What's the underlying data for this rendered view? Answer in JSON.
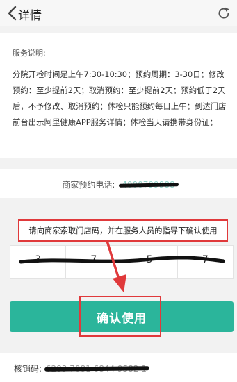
{
  "header": {
    "title": "详情",
    "back_icon": "chevron-left-icon",
    "refresh_icon": "refresh-icon"
  },
  "service": {
    "label": "服务说明:",
    "description": "分院开检时间是上午7:30-10:30；预约周期：3-30日；修改预约：至少提前2天；取消预约：至少提前2天；预约低于2天后，不予修改、取消预约；体检只能预约每日上午；到达门店前台出示阿里健康APP服务详情；体检当天请携带身份证；"
  },
  "phone": {
    "label": "商家预约电话:",
    "value": "4000799988"
  },
  "instruction": {
    "text": "请向商家索取门店码，并在服务人员的指导下确认使用"
  },
  "store_code": {
    "cells": [
      "3",
      "7",
      "5",
      "7"
    ]
  },
  "confirm": {
    "label": "确认使用"
  },
  "verification": {
    "label": "核销码:",
    "value": "6283 7081 6844 9582 1"
  },
  "colors": {
    "accent": "#2bb59b",
    "annotation": "#e0393b"
  }
}
